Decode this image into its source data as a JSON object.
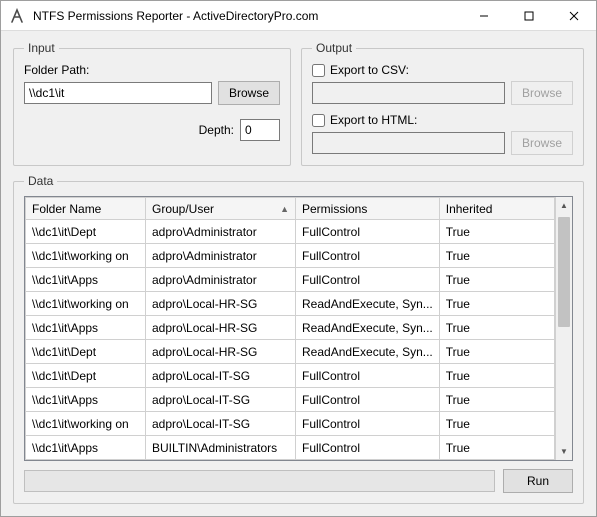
{
  "window": {
    "title": "NTFS Permissions Reporter - ActiveDirectoryPro.com"
  },
  "input": {
    "legend": "Input",
    "folder_label": "Folder Path:",
    "folder_value": "\\\\dc1\\it",
    "browse_label": "Browse",
    "depth_label": "Depth:",
    "depth_value": "0"
  },
  "output": {
    "legend": "Output",
    "export_csv_label": "Export to CSV:",
    "export_html_label": "Export to HTML:",
    "browse_label": "Browse"
  },
  "data": {
    "legend": "Data",
    "columns": {
      "folder": "Folder Name",
      "user": "Group/User",
      "perm": "Permissions",
      "inh": "Inherited"
    },
    "rows": [
      {
        "folder": "\\\\dc1\\it\\Dept",
        "user": "adpro\\Administrator",
        "perm": "FullControl",
        "inh": "True"
      },
      {
        "folder": "\\\\dc1\\it\\working on",
        "user": "adpro\\Administrator",
        "perm": "FullControl",
        "inh": "True"
      },
      {
        "folder": "\\\\dc1\\it\\Apps",
        "user": "adpro\\Administrator",
        "perm": "FullControl",
        "inh": "True"
      },
      {
        "folder": "\\\\dc1\\it\\working on",
        "user": "adpro\\Local-HR-SG",
        "perm": "ReadAndExecute, Syn...",
        "inh": "True"
      },
      {
        "folder": "\\\\dc1\\it\\Apps",
        "user": "adpro\\Local-HR-SG",
        "perm": "ReadAndExecute, Syn...",
        "inh": "True"
      },
      {
        "folder": "\\\\dc1\\it\\Dept",
        "user": "adpro\\Local-HR-SG",
        "perm": "ReadAndExecute, Syn...",
        "inh": "True"
      },
      {
        "folder": "\\\\dc1\\it\\Dept",
        "user": "adpro\\Local-IT-SG",
        "perm": "FullControl",
        "inh": "True"
      },
      {
        "folder": "\\\\dc1\\it\\Apps",
        "user": "adpro\\Local-IT-SG",
        "perm": "FullControl",
        "inh": "True"
      },
      {
        "folder": "\\\\dc1\\it\\working on",
        "user": "adpro\\Local-IT-SG",
        "perm": "FullControl",
        "inh": "True"
      },
      {
        "folder": "\\\\dc1\\it\\Apps",
        "user": "BUILTIN\\Administrators",
        "perm": "FullControl",
        "inh": "True"
      }
    ],
    "run_label": "Run"
  }
}
